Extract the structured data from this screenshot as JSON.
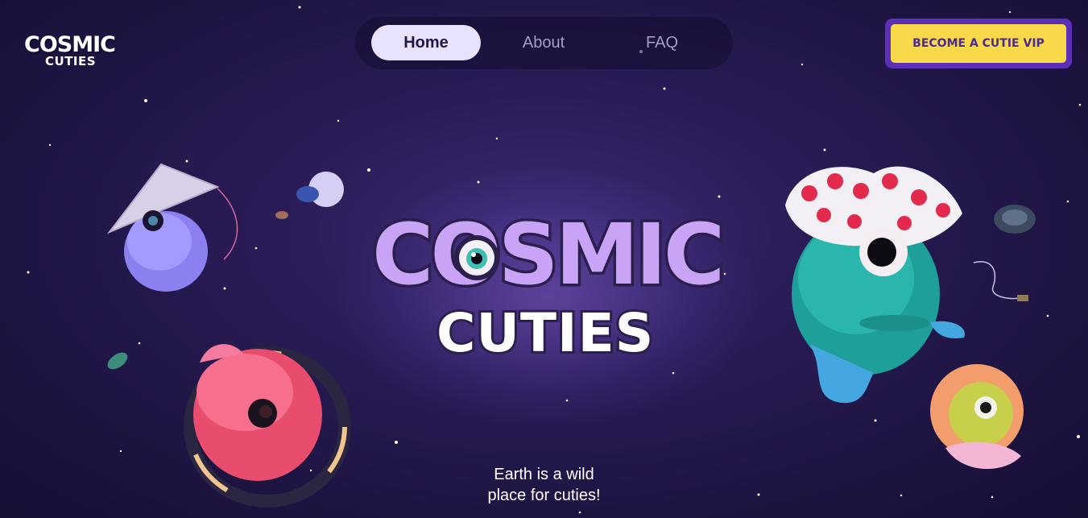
{
  "header": {
    "logo": {
      "line1": "COSMIC",
      "line2": "CUTIES"
    },
    "nav": [
      {
        "label": "Home",
        "active": true
      },
      {
        "label": "About",
        "active": false
      },
      {
        "label": "FAQ",
        "active": false
      }
    ],
    "cta_label": "BECOME A CUTIE VIP"
  },
  "hero": {
    "title_line1": "COSMIC",
    "title_line2": "CUTIES",
    "tagline_line1": "Earth is a wild",
    "tagline_line2": "place for cuties!"
  },
  "colors": {
    "background": "#221850",
    "nav_active_bg": "#e8e2ff",
    "cta_bg": "#f8d94a",
    "cta_border": "#5b2fb6",
    "title_purple": "#c9a3f5"
  }
}
